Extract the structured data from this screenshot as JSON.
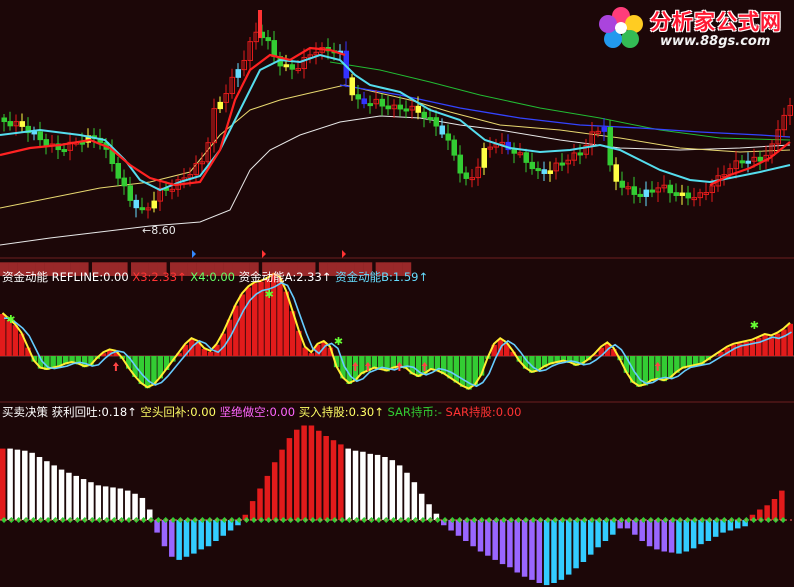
{
  "logo": {
    "title": "分析家公式网",
    "url": "www.88gs.com",
    "icon": "flower-logo-icon"
  },
  "colors": {
    "background": "#1c0708",
    "up_bar": "#e21b1b",
    "down_bar": "#33cc33",
    "violet_bar": "#9966ff",
    "cyan_bar": "#33ccff",
    "white_bar": "#ffffff",
    "ma_red": "#ff2222",
    "ma_cyan": "#55ddee",
    "ma_yellow": "#e8d870",
    "ma_green": "#22bb33",
    "ma_blue": "#3344ff",
    "ma_white": "#e8e8e8",
    "grid": "#6b1f1f"
  },
  "main_panel": {
    "low_annotation": "←8.60",
    "header_overlap_text": "██████████ ████ ████  ██████████ ██████  ██████ ████"
  },
  "indicator1": {
    "segments": [
      {
        "text": "资金动能  REFLINE:0.00  ",
        "color": "#ffffff"
      },
      {
        "text": "X3:2.33↑",
        "color": "#ff3333"
      },
      {
        "text": "  X4:0.00",
        "color": "#66ff66"
      },
      {
        "text": "                                    资金动能A:2.33↑",
        "color": "#ffffff"
      },
      {
        "text": "  资金动能B:1.59↑",
        "color": "#66ddff"
      }
    ]
  },
  "indicator2": {
    "segments": [
      {
        "text": "买卖决策  ",
        "color": "#ffffff"
      },
      {
        "text": "获利回吐:0.18↑",
        "color": "#ffffff"
      },
      {
        "text": "  空头回补:0.00",
        "color": "#ffff66"
      },
      {
        "text": "  坚绝做空:0.00",
        "color": "#ff66ff"
      },
      {
        "text": "  买入持股:0.30↑",
        "color": "#ffff66"
      },
      {
        "text": "                        SAR持币:-",
        "color": "#33cc33"
      },
      {
        "text": "  SAR持股:0.00",
        "color": "#ff3333"
      }
    ]
  },
  "chart_data": [
    {
      "type": "candlestick",
      "title": "",
      "lowest_marked": 8.6,
      "note": "price candles with moving averages; only the low marker price is printed"
    },
    {
      "type": "bar",
      "title": "资金动能",
      "series": [
        {
          "name": "REFLINE",
          "last": 0.0
        },
        {
          "name": "X3",
          "last": 2.33
        },
        {
          "name": "X4",
          "last": 0.0
        },
        {
          "name": "资金动能A",
          "last": 2.33
        },
        {
          "name": "资金动能B",
          "last": 1.59
        }
      ],
      "values": [
        3.0,
        2.6,
        2.2,
        1.6,
        0.6,
        -0.4,
        -0.9,
        -1.0,
        -0.9,
        -0.8,
        -0.6,
        -0.5,
        -0.6,
        -0.8,
        -0.7,
        -0.2,
        0.2,
        0.4,
        0.3,
        -0.2,
        -0.9,
        -1.5,
        -2.0,
        -2.3,
        -2.1,
        -1.6,
        -1.0,
        -0.4,
        0.2,
        0.8,
        1.2,
        1.0,
        0.5,
        0.3,
        0.8,
        1.6,
        2.6,
        3.6,
        4.4,
        4.9,
        5.2,
        5.3,
        5.5,
        5.8,
        5.6,
        4.6,
        3.2,
        1.8,
        0.6,
        0.2,
        0.8,
        1.0,
        0.6,
        -0.8,
        -1.6,
        -2.0,
        -1.8,
        -1.3,
        -1.1,
        -0.9,
        -1.0,
        -1.1,
        -0.9,
        -0.8,
        -0.9,
        -1.3,
        -1.5,
        -1.3,
        -1.0,
        -1.1,
        -1.3,
        -1.6,
        -1.9,
        -2.2,
        -2.4,
        -2.1,
        -1.4,
        -0.2,
        0.8,
        1.2,
        0.9,
        0.3,
        -0.4,
        -0.9,
        -1.2,
        -1.1,
        -0.8,
        -0.6,
        -0.5,
        -0.4,
        -0.5,
        -0.7,
        -0.6,
        -0.3,
        0.1,
        0.6,
        0.9,
        0.5,
        -0.3,
        -1.2,
        -1.9,
        -2.2,
        -2.1,
        -1.8,
        -1.7,
        -1.8,
        -1.6,
        -1.2,
        -0.9,
        -0.8,
        -0.7,
        -0.6,
        -0.3,
        0.0,
        0.3,
        0.6,
        0.8,
        0.9,
        1.0,
        1.1,
        1.3,
        1.5,
        1.4,
        1.6,
        1.9,
        2.3
      ],
      "ylim": [
        -3,
        6.5
      ]
    },
    {
      "type": "bar",
      "title": "买卖决策",
      "series": [
        {
          "name": "获利回吐",
          "last": 0.18
        },
        {
          "name": "空头回补",
          "last": 0.0
        },
        {
          "name": "坚绝做空",
          "last": 0.0
        },
        {
          "name": "买入持股",
          "last": 0.3
        },
        {
          "name": "SAR持币",
          "last": null
        },
        {
          "name": "SAR持股",
          "last": 0.0
        }
      ],
      "values": [
        0.68,
        0.68,
        0.67,
        0.66,
        0.64,
        0.6,
        0.56,
        0.52,
        0.48,
        0.45,
        0.42,
        0.39,
        0.36,
        0.33,
        0.32,
        0.31,
        0.3,
        0.28,
        0.25,
        0.21,
        0.1,
        -0.12,
        -0.25,
        -0.35,
        -0.38,
        -0.35,
        -0.32,
        -0.28,
        -0.25,
        -0.2,
        -0.15,
        -0.1,
        -0.05,
        0.05,
        0.18,
        0.3,
        0.42,
        0.55,
        0.67,
        0.78,
        0.86,
        0.9,
        0.9,
        0.85,
        0.8,
        0.76,
        0.72,
        0.68,
        0.66,
        0.65,
        0.63,
        0.62,
        0.6,
        0.57,
        0.52,
        0.45,
        0.36,
        0.25,
        0.15,
        0.06,
        -0.05,
        -0.1,
        -0.15,
        -0.2,
        -0.25,
        -0.3,
        -0.34,
        -0.38,
        -0.42,
        -0.45,
        -0.5,
        -0.54,
        -0.57,
        -0.6,
        -0.62,
        -0.6,
        -0.57,
        -0.52,
        -0.46,
        -0.4,
        -0.33,
        -0.26,
        -0.2,
        -0.14,
        -0.08,
        -0.08,
        -0.14,
        -0.2,
        -0.25,
        -0.28,
        -0.3,
        -0.31,
        -0.32,
        -0.3,
        -0.27,
        -0.23,
        -0.2,
        -0.16,
        -0.12,
        -0.1,
        -0.08,
        -0.06,
        0.05,
        0.1,
        0.14,
        0.2,
        0.28
      ],
      "ylim": [
        -0.75,
        1.0
      ]
    }
  ]
}
